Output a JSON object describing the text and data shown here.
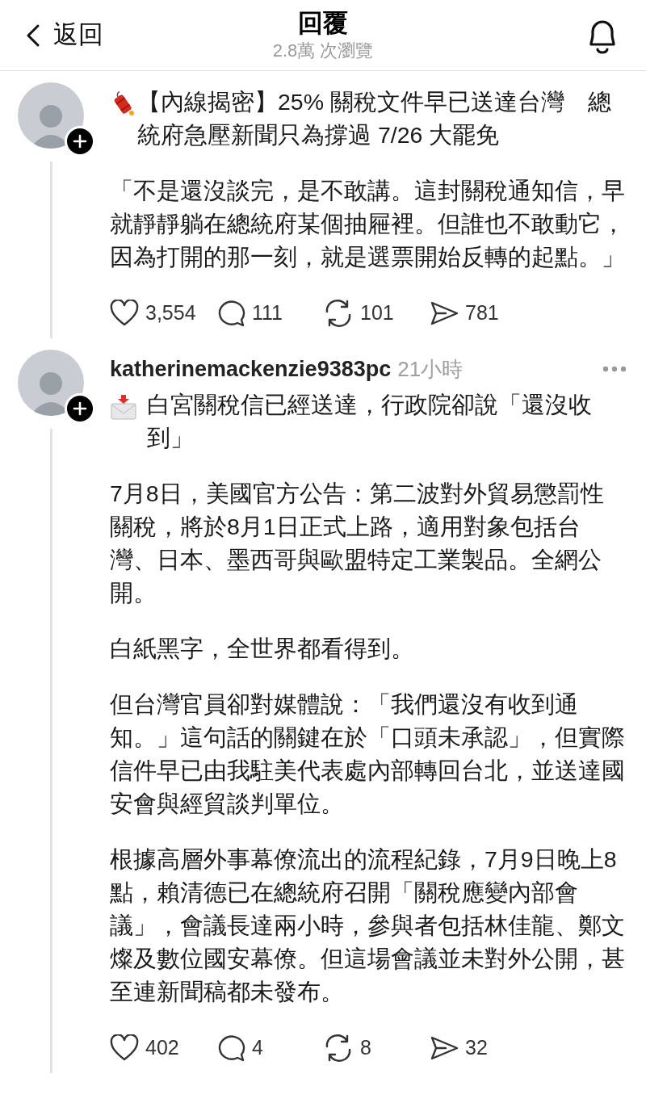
{
  "header": {
    "back_label": "返回",
    "title": "回覆",
    "views": "2.8萬 次瀏覽"
  },
  "posts": [
    {
      "kind": "firecracker",
      "paragraphs": [
        "【內線揭密】25% 關稅文件早已送達台灣　總統府急壓新聞只為撐過 7/26 大罷免",
        "「不是還沒談完，是不敢講。這封關稅通知信，早就靜靜躺在總統府某個抽屜裡。但誰也不敢動它，因為打開的那一刻，就是選票開始反轉的起點。」"
      ],
      "likes": "3,554",
      "replies": "111",
      "reposts": "101",
      "shares": "781"
    },
    {
      "kind": "envelope",
      "author": "katherinemackenzie9383pc",
      "time": "21小時",
      "paragraphs": [
        "白宮關稅信已經送達，行政院卻說「還沒收到」",
        "7月8日，美國官方公告：第二波對外貿易懲罰性關稅，將於8月1日正式上路，適用對象包括台灣、日本、墨西哥與歐盟特定工業製品。全網公開。",
        "白紙黑字，全世界都看得到。",
        "但台灣官員卻對媒體說：「我們還沒有收到通知。」這句話的關鍵在於「口頭未承認」，但實際信件早已由我駐美代表處內部轉回台北，並送達國安會與經貿談判單位。",
        "根據高層外事幕僚流出的流程紀錄，7月9日晚上8點，賴清德已在總統府召開「關稅應變內部會議」，會議長達兩小時，參與者包括林佳龍、鄭文燦及數位國安幕僚。但這場會議並未對外公開，甚至連新聞稿都未發布。"
      ],
      "likes": "402",
      "replies": "4",
      "reposts": "8",
      "shares": "32"
    }
  ]
}
